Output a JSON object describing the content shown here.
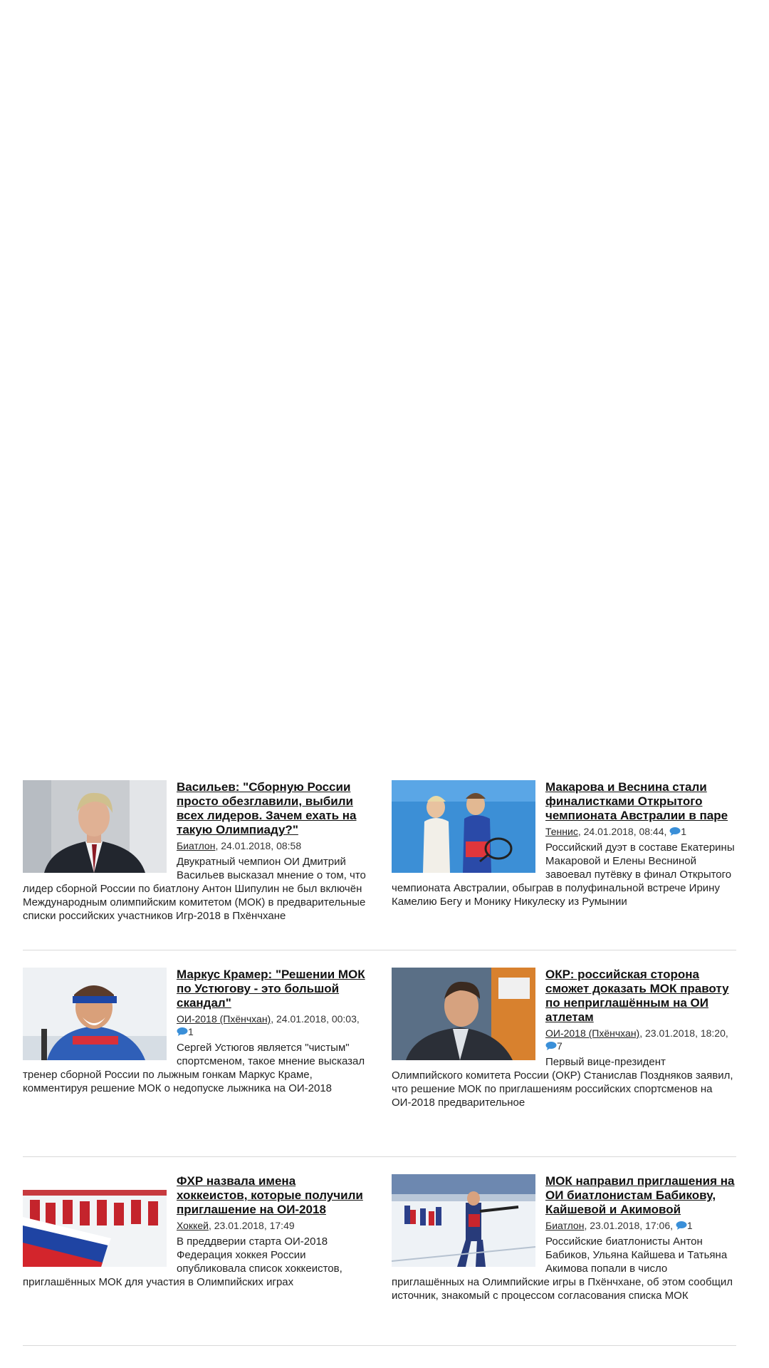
{
  "news": [
    {
      "title": "Васильев: \"Сборную России просто обезглавили, выбили всех лидеров. Зачем ехать на такую Олимпиаду?\"",
      "category": "Биатлон",
      "date": ", 24.01.2018, 08:58",
      "comments": "",
      "lead": "Двукратный чемпион ОИ Дмитрий Васильев высказал мнение о том, что лидер сборной России по биатлону Антон Шипулин не был включён Международным олимпийским комитетом (МОК) в предварительные списки российских участников Игр-2018 в Пхёнчхане",
      "image": "man-in-suit-photo"
    },
    {
      "title": "Макарова и Веснина стали финалистками Открытого чемпионата Австралии в паре",
      "category": "Теннис",
      "date": ", 24.01.2018, 08:44,",
      "comments": "1",
      "lead": "Российский дуэт в составе Екатерины Макаровой и Елены Весниной завоевал путёвку в финал Открытого чемпионата Австралии, обыграв в полуфинальной встрече Ирину Камелию Бегу и Монику Никулеску из Румынии",
      "image": "tennis-players-photo"
    },
    {
      "title": "Маркус Крамер: \"Решении МОК по Устюгову - это большой скандал\"",
      "category": "ОИ-2018 (Пхёнчхан)",
      "date": ", 24.01.2018, 00:03,",
      "comments": "1",
      "lead": "Сергей Устюгов является \"чистым\" спортсменом, такое мнение высказал тренер сборной России по лыжным гонкам Маркус Краме, комментируя решение МОК о недопуске лыжника на ОИ-2018",
      "image": "skier-portrait-photo"
    },
    {
      "title": "ОКР: российская сторона сможет доказать МОК правоту по неприглашённым на ОИ атлетам",
      "category": "ОИ-2018 (Пхёнчхан)",
      "date": ", 23.01.2018, 18:20,",
      "comments": "7",
      "lead": "Первый вице-президент Олимпийского комитета России (ОКР) Станислав Поздняков заявил, что решение МОК по приглашениям российских спортсменов на ОИ-2018 предварительное",
      "image": "official-photo"
    },
    {
      "title": "ФХР назвала имена хоккеистов, которые получили приглашение на ОИ-2018",
      "category": "Хоккей",
      "date": ", 23.01.2018, 17:49",
      "comments": "",
      "lead": "В преддверии старта ОИ-2018 Федерация хоккея России опубликовала список хоккеистов, приглашённых МОК для участия в Олимпийских играх",
      "image": "hockey-team-photo"
    },
    {
      "title": "МОК направил приглашения на ОИ биатлонистам Бабикову, Кайшевой и Акимовой",
      "category": "Биатлон",
      "date": ", 23.01.2018, 17:06,",
      "comments": "1",
      "lead": "Российские биатлонисты Антон Бабиков, Ульяна Кайшева и Татьяна Акимова попали в число приглашённых на Олимпийские игры в Пхёнчхане, об этом сообщил источник, знакомый с процессом согласования списка МОК",
      "image": "biathlon-range-photo"
    }
  ],
  "colors": {
    "comment_icon": "#3a8fd8",
    "divider": "#d9d9d9"
  }
}
